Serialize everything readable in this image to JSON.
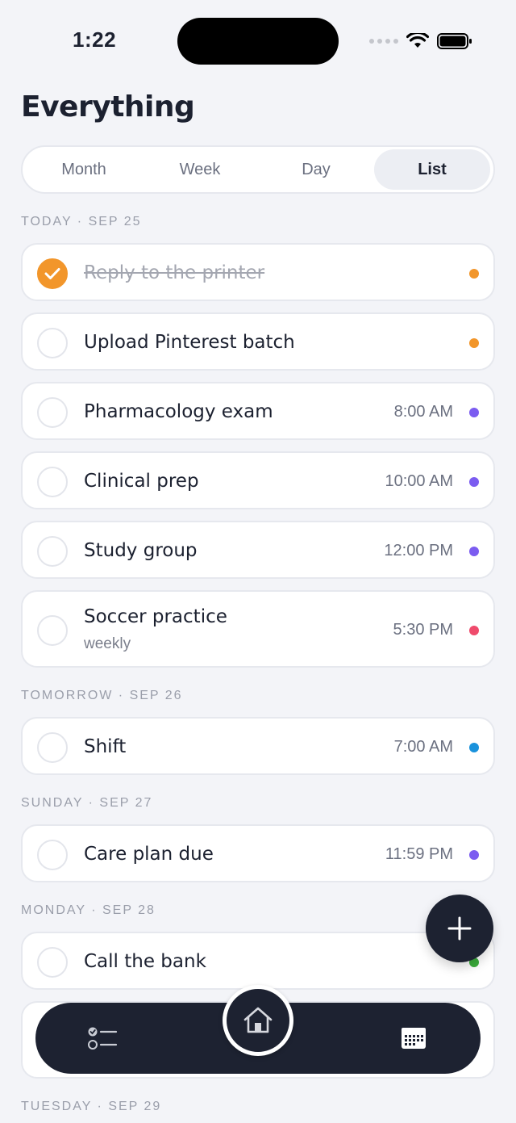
{
  "status": {
    "time": "1:22"
  },
  "header": {
    "title": "Everything"
  },
  "tabs": [
    {
      "label": "Month",
      "active": false
    },
    {
      "label": "Week",
      "active": false
    },
    {
      "label": "Day",
      "active": false
    },
    {
      "label": "List",
      "active": true
    }
  ],
  "sections": [
    {
      "label": "TODAY · SEP 25"
    },
    {
      "label": "TOMORROW · SEP 26"
    },
    {
      "label": "SUNDAY · SEP 27"
    },
    {
      "label": "MONDAY · SEP 28"
    },
    {
      "label": "TUESDAY · SEP 29"
    }
  ],
  "tasks": [
    {
      "title": "Reply to the printer",
      "time": "",
      "subtitle": "",
      "done": true,
      "color": "#f2962b"
    },
    {
      "title": "Upload Pinterest batch",
      "time": "",
      "subtitle": "",
      "done": false,
      "color": "#f2962b"
    },
    {
      "title": "Pharmacology exam",
      "time": "8:00 AM",
      "subtitle": "",
      "done": false,
      "color": "#7b5cf0"
    },
    {
      "title": "Clinical prep",
      "time": "10:00 AM",
      "subtitle": "",
      "done": false,
      "color": "#7b5cf0"
    },
    {
      "title": "Study group",
      "time": "12:00 PM",
      "subtitle": "",
      "done": false,
      "color": "#7b5cf0"
    },
    {
      "title": "Soccer practice",
      "time": "5:30 PM",
      "subtitle": "weekly",
      "done": false,
      "color": "#ef4b6c"
    },
    {
      "title": "Shift",
      "time": "7:00 AM",
      "subtitle": "",
      "done": false,
      "color": "#1a92dc"
    },
    {
      "title": "Care plan due",
      "time": "11:59 PM",
      "subtitle": "",
      "done": false,
      "color": "#7b5cf0"
    },
    {
      "title": "Call the bank",
      "time": "",
      "subtitle": "",
      "done": false,
      "color": "#3cae3c"
    }
  ],
  "icons": {
    "fab": "plus-icon",
    "nav_left": "checklist-icon",
    "nav_center": "home-icon",
    "nav_right": "calendar-icon"
  }
}
